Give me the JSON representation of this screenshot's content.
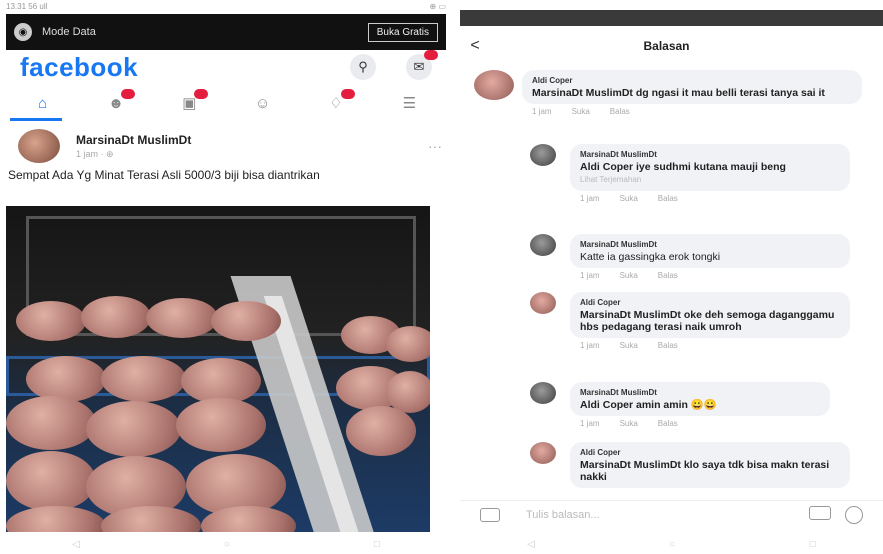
{
  "left": {
    "status_time": "13.31  56 ull",
    "status_right": "⊕ ▭",
    "mode_label": "Mode Data",
    "mode_button": "Buka Gratis",
    "logo": "facebook",
    "post": {
      "author": "MarsinaDt MuslimDt",
      "meta": "1 jam · ⊕",
      "more": "···",
      "text": "Sempat Ada Yg Minat Terasi Asli 5000/3  biji bisa diantrikan"
    },
    "nav_icons": [
      "home-icon",
      "friends-icon",
      "groups-icon",
      "profile-icon",
      "notifications-icon",
      "menu-icon"
    ],
    "accent": "#1877f2",
    "footer": [
      "◁",
      "○",
      "□"
    ]
  },
  "right": {
    "title": "Balasan",
    "back": "<",
    "comments": [
      {
        "name": "Aldi Coper",
        "text": "MarsinaDt MuslimDt dg ngasi it mau belli terasi tanya sai it",
        "sub": "",
        "time": "1 jam",
        "like": "Suka",
        "reply": "Balas",
        "indent": false,
        "dark": false
      },
      {
        "name": "MarsinaDt MuslimDt",
        "text": "Aldi Coper iye sudhmi kutana mauji beng",
        "sub": "Lihat Terjemahan",
        "time": "1 jam",
        "like": "Suka",
        "reply": "Balas",
        "indent": true,
        "dark": true
      },
      {
        "name": "MarsinaDt MuslimDt",
        "text": "Katte ia gassingka erok tongki",
        "sub": "",
        "time": "1 jam",
        "like": "Suka",
        "reply": "Balas",
        "indent": true,
        "dark": true
      },
      {
        "name": "Aldi Coper",
        "text": "MarsinaDt MuslimDt oke deh semoga daganggamu hbs pedagang terasi naik umroh",
        "sub": "",
        "time": "1 jam",
        "like": "Suka",
        "reply": "Balas",
        "indent": true,
        "dark": false
      },
      {
        "name": "MarsinaDt MuslimDt",
        "text": "Aldi Coper amin amin 😀😀",
        "sub": "",
        "time": "1 jam",
        "like": "Suka",
        "reply": "Balas",
        "indent": true,
        "dark": true
      },
      {
        "name": "Aldi Coper",
        "text": "MarsinaDt MuslimDt  klo saya tdk bisa makn terasi nakki",
        "sub": "",
        "time": "",
        "like": "",
        "reply": "",
        "indent": true,
        "dark": false
      }
    ],
    "input_placeholder": "Tulis balasan...",
    "footer": [
      "◁",
      "○",
      "□"
    ]
  }
}
